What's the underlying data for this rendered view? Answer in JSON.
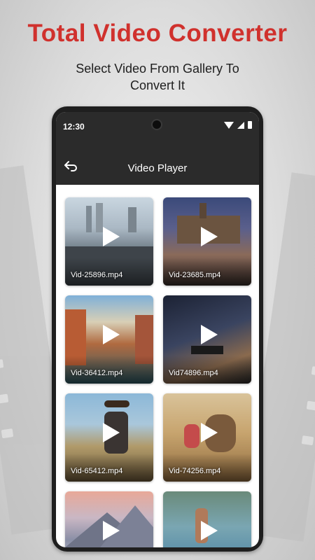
{
  "promo": {
    "headline": "Total Video Converter",
    "subline_1": "Select Video From Gallery To",
    "subline_2": "Convert It"
  },
  "status_bar": {
    "time": "12:30",
    "icons": [
      "wifi-icon",
      "signal-icon",
      "battery-icon"
    ]
  },
  "app_bar": {
    "title": "Video Player",
    "back_icon": "back-arrow-icon"
  },
  "videos": [
    {
      "name": "Vid-25896.mp4",
      "scene": "city-pier"
    },
    {
      "name": "Vid-23685.mp4",
      "scene": "night-palace"
    },
    {
      "name": "Vid-36412.mp4",
      "scene": "venice-canal"
    },
    {
      "name": "Vid74896.mp4",
      "scene": "milky-way-bench"
    },
    {
      "name": "Vid-65412.mp4",
      "scene": "guitarist"
    },
    {
      "name": "Vid-74256.mp4",
      "scene": "dog-child"
    },
    {
      "name": "",
      "scene": "pink-mountains"
    },
    {
      "name": "",
      "scene": "coast-woman"
    }
  ],
  "colors": {
    "headline": "#d0312d",
    "app_bar": "#2b2b2b"
  }
}
